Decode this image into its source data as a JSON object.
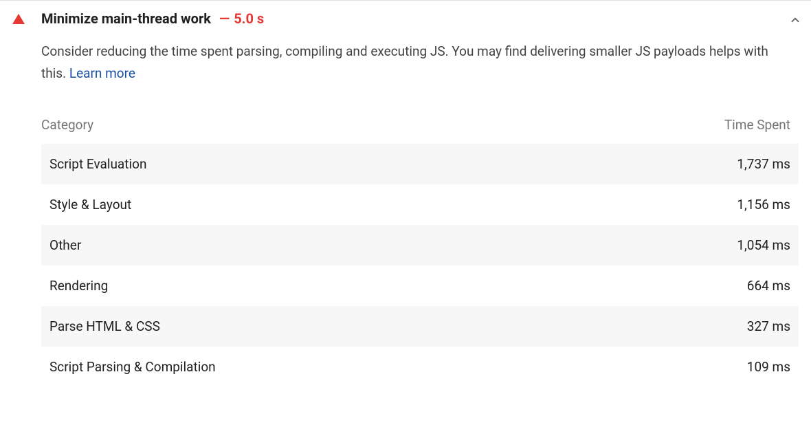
{
  "audit": {
    "title": "Minimize main-thread work",
    "dash": "—",
    "value": "5.0 s",
    "description_pre": "Consider reducing the time spent parsing, compiling and executing JS. You may find delivering smaller JS payloads helps with this. ",
    "learn_more": "Learn more"
  },
  "table": {
    "col_category": "Category",
    "col_time": "Time Spent",
    "rows": [
      {
        "category": "Script Evaluation",
        "time": "1,737 ms"
      },
      {
        "category": "Style & Layout",
        "time": "1,156 ms"
      },
      {
        "category": "Other",
        "time": "1,054 ms"
      },
      {
        "category": "Rendering",
        "time": "664 ms"
      },
      {
        "category": "Parse HTML & CSS",
        "time": "327 ms"
      },
      {
        "category": "Script Parsing & Compilation",
        "time": "109 ms"
      }
    ]
  }
}
